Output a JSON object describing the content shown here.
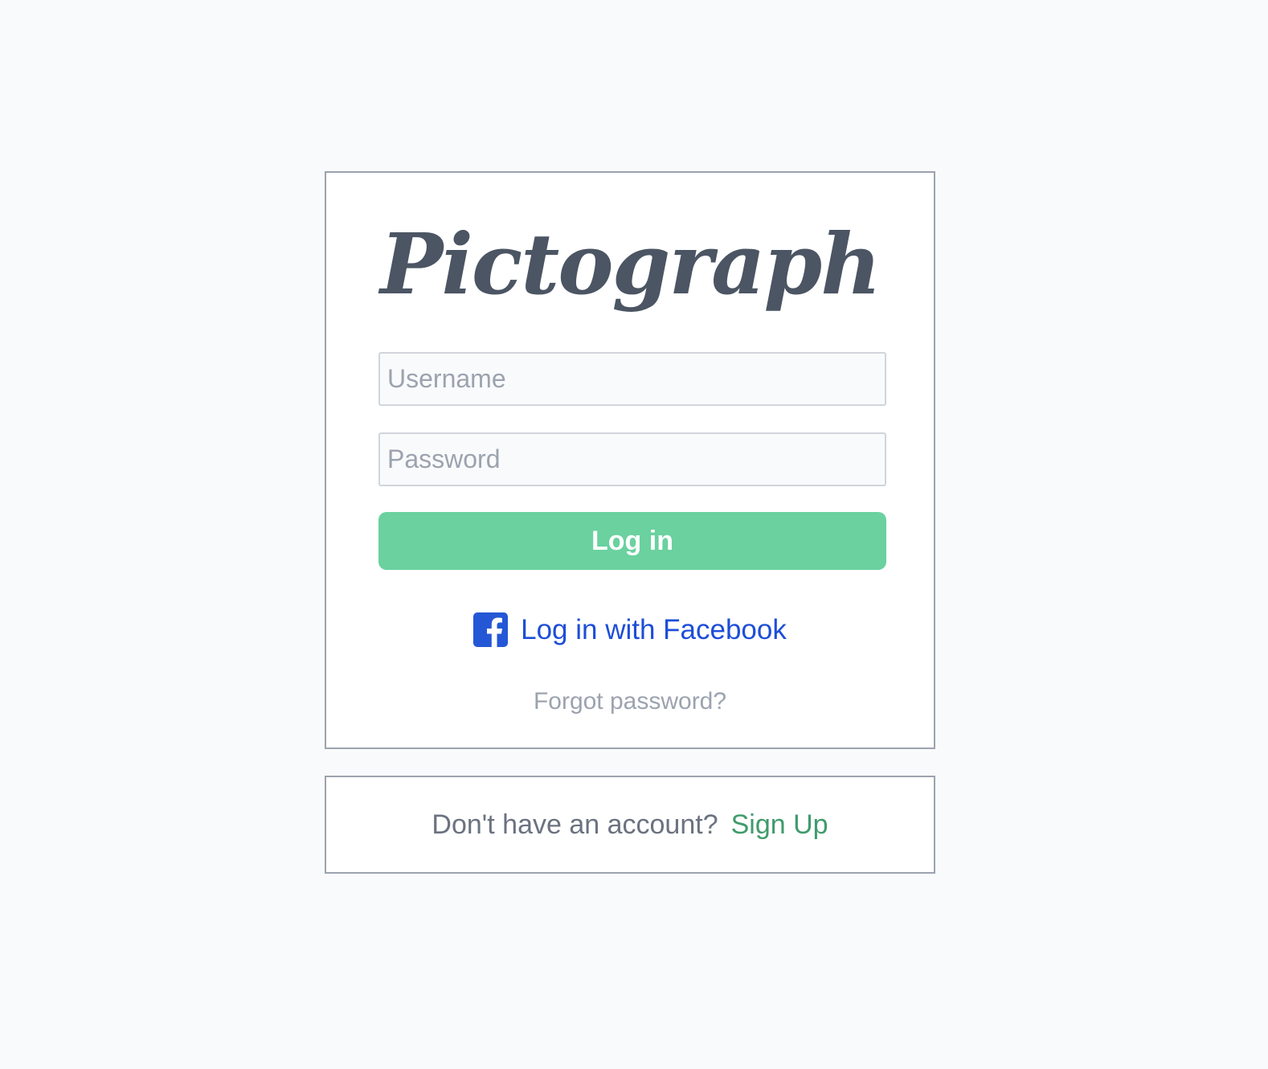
{
  "app": {
    "logo_text": "Pictograph"
  },
  "login_form": {
    "username_placeholder": "Username",
    "username_value": "",
    "password_placeholder": "Password",
    "password_value": "",
    "login_button_label": "Log in",
    "facebook_icon": "facebook-square-icon",
    "facebook_label": "Log in with Facebook",
    "forgot_password_label": "Forgot password?"
  },
  "signup": {
    "question": "Don't have an account?",
    "link_label": "Sign Up"
  },
  "colors": {
    "background": "#f9fafb",
    "card_border": "#9ca3af",
    "logo": "#4b5563",
    "login_button": "#6ad19f",
    "facebook_blue": "#2457d6",
    "facebook_text": "#1d4ed8",
    "signup_link": "#3f9b6b"
  }
}
